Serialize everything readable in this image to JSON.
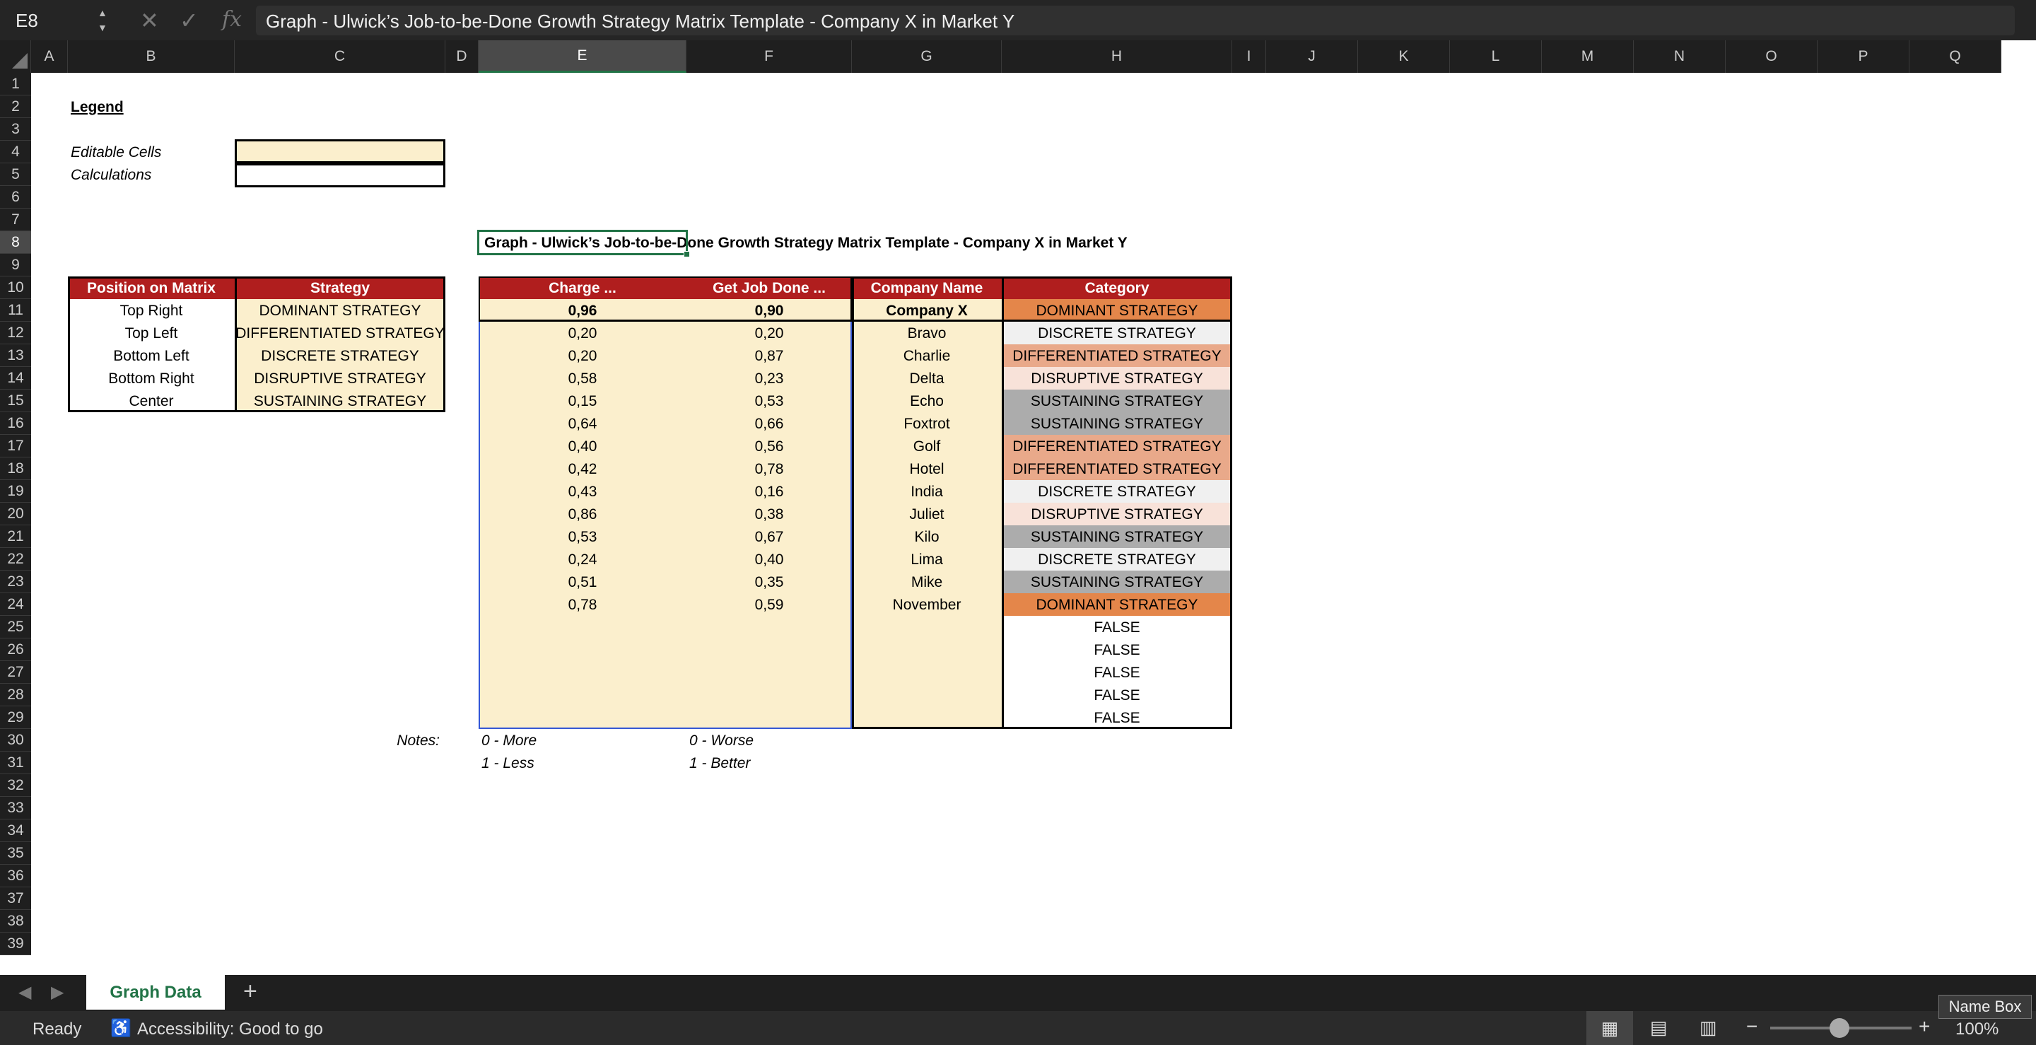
{
  "formula_bar": {
    "name_box": "E8",
    "formula": "Graph - Ulwick’s Job-to-be-Done Growth Strategy Matrix Template - Company X in Market Y"
  },
  "columns": [
    "A",
    "B",
    "C",
    "D",
    "E",
    "F",
    "G",
    "H",
    "I",
    "J",
    "K",
    "L",
    "M",
    "N",
    "O",
    "P",
    "Q"
  ],
  "rows": [
    "1",
    "2",
    "3",
    "4",
    "5",
    "6",
    "7",
    "8",
    "9",
    "10",
    "11",
    "12",
    "13",
    "14",
    "15",
    "16",
    "17",
    "18",
    "19",
    "20",
    "21",
    "22",
    "23",
    "24",
    "25",
    "26",
    "27",
    "28",
    "29",
    "30",
    "31",
    "32",
    "33",
    "34",
    "35",
    "36",
    "37",
    "38",
    "39"
  ],
  "legend": {
    "title": "Legend",
    "editable": "Editable Cells",
    "calculations": "Calculations"
  },
  "graph_title": "Graph - Ulwick’s Job-to-be-Done Growth Strategy Matrix Template - Company X in Market Y",
  "matrix": {
    "headers": [
      "Position on Matrix",
      "Strategy"
    ],
    "rows": [
      [
        "Top Right",
        "DOMINANT STRATEGY"
      ],
      [
        "Top Left",
        "DIFFERENTIATED STRATEGY"
      ],
      [
        "Bottom Left",
        "DISCRETE STRATEGY"
      ],
      [
        "Bottom Right",
        "DISRUPTIVE STRATEGY"
      ],
      [
        "Center",
        "SUSTAINING STRATEGY"
      ]
    ]
  },
  "data_table": {
    "headers": [
      "Charge ...",
      "Get Job Done ...",
      "Company Name",
      "Category"
    ],
    "rows": [
      [
        "0,96",
        "0,90",
        "Company X",
        "DOMINANT STRATEGY"
      ],
      [
        "0,20",
        "0,20",
        "Bravo",
        "DISCRETE STRATEGY"
      ],
      [
        "0,20",
        "0,87",
        "Charlie",
        "DIFFERENTIATED STRATEGY"
      ],
      [
        "0,58",
        "0,23",
        "Delta",
        "DISRUPTIVE STRATEGY"
      ],
      [
        "0,15",
        "0,53",
        "Echo",
        "SUSTAINING STRATEGY"
      ],
      [
        "0,64",
        "0,66",
        "Foxtrot",
        "SUSTAINING STRATEGY"
      ],
      [
        "0,40",
        "0,56",
        "Golf",
        "DIFFERENTIATED STRATEGY"
      ],
      [
        "0,42",
        "0,78",
        "Hotel",
        "DIFFERENTIATED STRATEGY"
      ],
      [
        "0,43",
        "0,16",
        "India",
        "DISCRETE STRATEGY"
      ],
      [
        "0,86",
        "0,38",
        "Juliet",
        "DISRUPTIVE STRATEGY"
      ],
      [
        "0,53",
        "0,67",
        "Kilo",
        "SUSTAINING STRATEGY"
      ],
      [
        "0,24",
        "0,40",
        "Lima",
        "DISCRETE STRATEGY"
      ],
      [
        "0,51",
        "0,35",
        "Mike",
        "SUSTAINING STRATEGY"
      ],
      [
        "0,78",
        "0,59",
        "November",
        "DOMINANT STRATEGY"
      ],
      [
        "",
        "",
        "",
        "FALSE"
      ],
      [
        "",
        "",
        "",
        "FALSE"
      ],
      [
        "",
        "",
        "",
        "FALSE"
      ],
      [
        "",
        "",
        "",
        "FALSE"
      ],
      [
        "",
        "",
        "",
        "FALSE"
      ]
    ]
  },
  "notes": {
    "label": "Notes:",
    "e1": "0 - More",
    "e2": "1 - Less",
    "f1": "0 - Worse",
    "f2": "1 - Better"
  },
  "sheet_tab": "Graph Data",
  "tooltip": "Name Box",
  "status": {
    "ready": "Ready",
    "accessibility": "Accessibility: Good to go",
    "zoom": "100%"
  },
  "colors": {
    "header_red": "#b01e1e",
    "editable": "#fbefcd",
    "dominant": "#e4864a",
    "differentiated": "#e9a98a",
    "discrete": "#f0f0f0",
    "disruptive": "#f8e2d9",
    "sustaining": "#acacac",
    "accent_green": "#217346"
  }
}
